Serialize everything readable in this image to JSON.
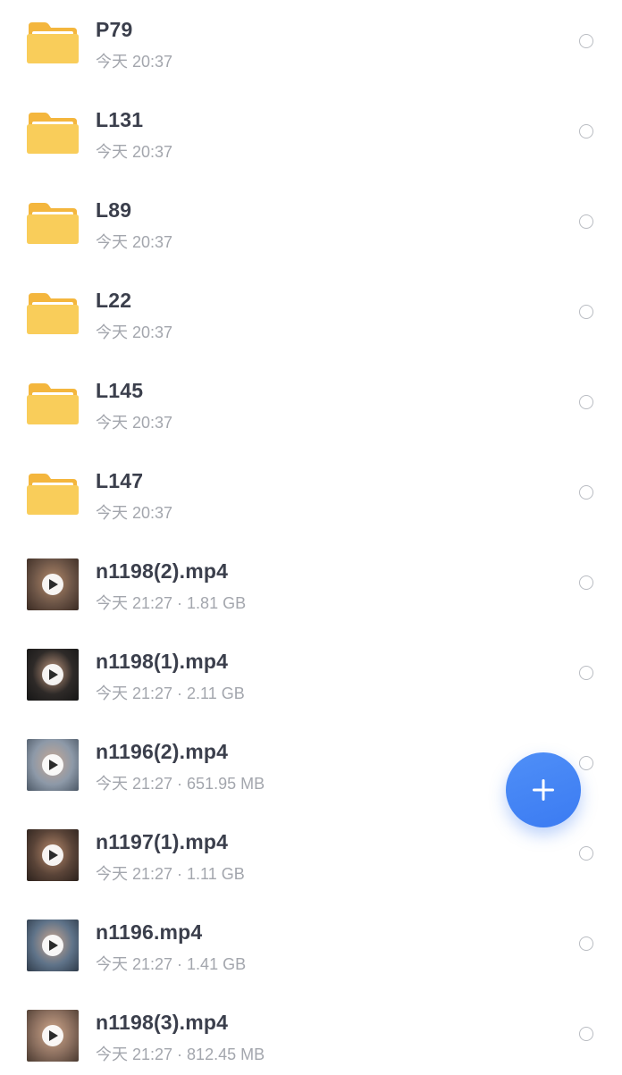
{
  "files": [
    {
      "kind": "folder",
      "name": "P79",
      "date": "今天 20:37",
      "size": ""
    },
    {
      "kind": "folder",
      "name": "L131",
      "date": "今天 20:37",
      "size": ""
    },
    {
      "kind": "folder",
      "name": "L89",
      "date": "今天 20:37",
      "size": ""
    },
    {
      "kind": "folder",
      "name": "L22",
      "date": "今天 20:37",
      "size": ""
    },
    {
      "kind": "folder",
      "name": "L145",
      "date": "今天 20:37",
      "size": ""
    },
    {
      "kind": "folder",
      "name": "L147",
      "date": "今天 20:37",
      "size": ""
    },
    {
      "kind": "video",
      "name": "n1198(2).mp4",
      "date": "今天 21:27",
      "size": "1.81 GB",
      "thumb_colors": [
        "#6b5446",
        "#b58a6a",
        "#3a2a22"
      ]
    },
    {
      "kind": "video",
      "name": "n1198(1).mp4",
      "date": "今天 21:27",
      "size": "2.11 GB",
      "thumb_colors": [
        "#2e2a28",
        "#c49a80",
        "#151515"
      ]
    },
    {
      "kind": "video",
      "name": "n1196(2).mp4",
      "date": "今天 21:27",
      "size": "651.95 MB",
      "thumb_colors": [
        "#8d99a8",
        "#c8a894",
        "#4c5866"
      ]
    },
    {
      "kind": "video",
      "name": "n1197(1).mp4",
      "date": "今天 21:27",
      "size": "1.11 GB",
      "thumb_colors": [
        "#5a4438",
        "#b88a6c",
        "#2b211c"
      ]
    },
    {
      "kind": "video",
      "name": "n1196.mp4",
      "date": "今天 21:27",
      "size": "1.41 GB",
      "thumb_colors": [
        "#5f7389",
        "#cda890",
        "#2f3b4a"
      ]
    },
    {
      "kind": "video",
      "name": "n1198(3).mp4",
      "date": "今天 21:27",
      "size": "812.45 MB",
      "thumb_colors": [
        "#8a6e5e",
        "#d2a98c",
        "#4a3a30"
      ]
    }
  ],
  "icons": {
    "folder": "folder-icon",
    "play": "play-icon",
    "radio": "select-radio",
    "fab": "plus-icon"
  },
  "colors": {
    "folder_back": "#f4b63d",
    "folder_front": "#f9cd5a",
    "accent": "#3b7bf2",
    "name_text": "#3b3f4c",
    "meta_text": "#a3a6ad"
  },
  "fab": {
    "label": "+"
  }
}
